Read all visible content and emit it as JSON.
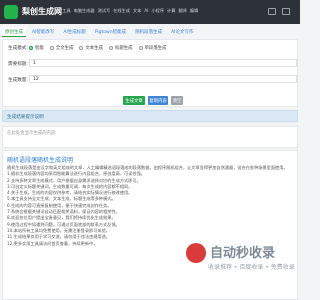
{
  "header": {
    "logo_text": "梨创生成网",
    "nav": [
      "AI写工具",
      "电脑生成器",
      "测试写",
      "在线生成",
      "文本",
      "AI",
      "小程序",
      "计算",
      "翻译",
      "编辑"
    ]
  },
  "tabs": [
    {
      "label": "原创生成"
    },
    {
      "label": "AI智能改写"
    },
    {
      "label": "AI生成标题"
    },
    {
      "label": "Pigtown智能成"
    },
    {
      "label": "随机段落生成"
    },
    {
      "label": "AI论文写作"
    }
  ],
  "form": {
    "mode_label": "生成模式:",
    "modes": [
      "智能",
      "全文生成",
      "文本生成",
      "标题生成",
      "单段落生成"
    ],
    "selected_mode": 0,
    "keyword_label": "需要标题:",
    "keyword_value": "1",
    "count_label": "生成数量:",
    "count_value": "12",
    "buttons": {
      "generate": "生成文章",
      "copy": "复制内容",
      "clear": "清空"
    }
  },
  "notice": "生成结果提示说明",
  "result_placeholder": "在此处会显示生成的内容",
  "article": {
    "title": "随机语段落随机生成说明",
    "paragraphs": [
      "随机生成段落是由汉字和英文组成的文章，人工编辑精选语段落成的段落数据，由程序随机组合，让文章显得更加自然通顺，适合在各种场景里面使用。",
      "1.随机生成段落内容均采用智能算法进行内容组合，原创度高，可读性强。",
      "2.支持多种文章生成模式，用户根据自身需求选择对应的生成方式即可。",
      "3.可自定义标题关键词，生成数量可调，每次生成的内容都不相同。",
      "4.关于生成，生成的内容仅供参考，请结合实际情况进行修改使用。",
      "5.本工具支持全文生成、文本生成、标题生成等多种模式。",
      "6.生成的内容可直接复制使用，便于快速完成创作任务。",
      "7.系统会根据关键词自动匹配相关语料，保证内容的相关性。",
      "8.欢迎各位用户提出宝贵意见，我们将持续优化生成效果。",
      "9.使用过程中如遇到问题，可通过页面底部的联系方式反馈。",
      "10.本站所有工具均免费使用，无需注册登录即可体验。",
      "11.生成结果仅用于学习交流，请勿用于违法违规用途。",
      "12.更多实用工具请访问首页查看，持续更新中。"
    ]
  },
  "watermark": {
    "text": "自动秒收录",
    "sub": "收录推荐  •  百度收录  •  免费收录"
  }
}
